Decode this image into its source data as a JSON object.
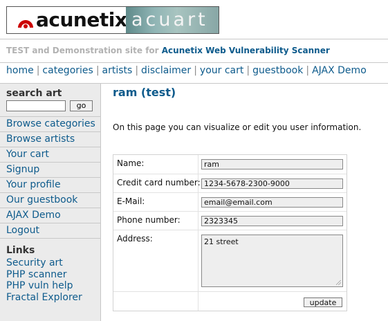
{
  "logo": {
    "brand": "acunetix",
    "product": "acuart",
    "brand_color": "#cc0000"
  },
  "tagline": {
    "text": "TEST and Demonstration site for ",
    "link": "Acunetix Web Vulnerability Scanner"
  },
  "menu": [
    {
      "label": "home"
    },
    {
      "label": "categories"
    },
    {
      "label": "artists"
    },
    {
      "label": "disclaimer"
    },
    {
      "label": "your cart"
    },
    {
      "label": "guestbook"
    },
    {
      "label": "AJAX Demo"
    }
  ],
  "sidebar": {
    "search_title": "search art",
    "search_value": "",
    "search_button": "go",
    "nav": [
      {
        "label": "Browse categories"
      },
      {
        "label": "Browse artists"
      },
      {
        "label": "Your cart"
      },
      {
        "label": "Signup"
      },
      {
        "label": "Your profile"
      },
      {
        "label": "Our guestbook"
      },
      {
        "label": "AJAX Demo"
      },
      {
        "label": "Logout"
      }
    ],
    "links_title": "Links",
    "links": [
      {
        "label": "Security art"
      },
      {
        "label": "PHP scanner"
      },
      {
        "label": "PHP vuln help"
      },
      {
        "label": "Fractal Explorer"
      }
    ]
  },
  "main": {
    "title": "ram (test)",
    "intro": "On this page you can visualize or edit you user information.",
    "form": {
      "name_label": "Name:",
      "name_value": "ram",
      "cc_label": "Credit card number:",
      "cc_value": "1234-5678-2300-9000",
      "email_label": "E-Mail:",
      "email_value": "email@email.com",
      "phone_label": "Phone number:",
      "phone_value": "2323345",
      "address_label": "Address:",
      "address_value": "21 street",
      "update_button": "update"
    }
  },
  "colors": {
    "link": "#0e5b8c",
    "tagline_gray": "#b2b2b2",
    "sidebar_bg": "#ebebeb",
    "input_bg": "#eeeeee"
  }
}
